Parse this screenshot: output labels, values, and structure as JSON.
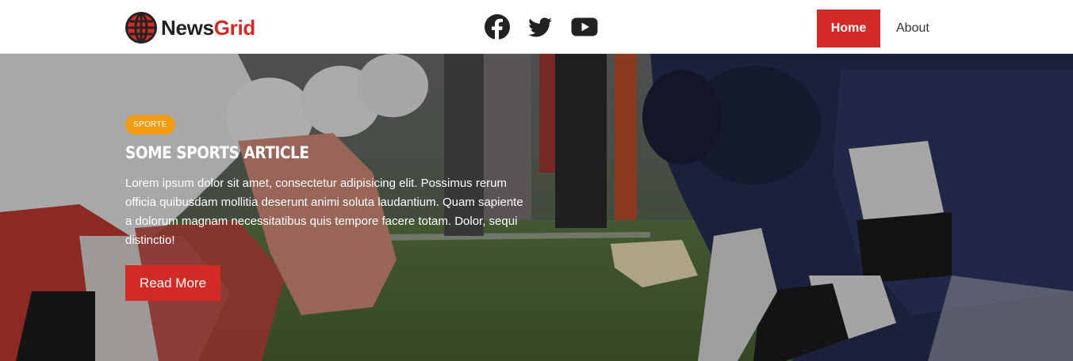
{
  "brand": {
    "name_part1": "News",
    "name_part2": "Grid"
  },
  "social": [
    {
      "icon": "facebook-icon"
    },
    {
      "icon": "twitter-icon"
    },
    {
      "icon": "youtube-icon"
    }
  ],
  "nav": {
    "home": "Home",
    "about": "About"
  },
  "hero": {
    "category": "SPORTE",
    "title": "Some Sports Article",
    "excerpt": "Lorem ipsum dolor sit amet, consectetur adipisicing elit. Possimus rerum officia quibusdam mollitia deserunt animi soluta laudantium. Quam sapiente a dolorum magnam necessitatibus quis tempore facere totam. Dolor, sequi distinctio!",
    "button": "Read More"
  },
  "colors": {
    "accent": "#d12a27",
    "badge": "#f39c12"
  }
}
